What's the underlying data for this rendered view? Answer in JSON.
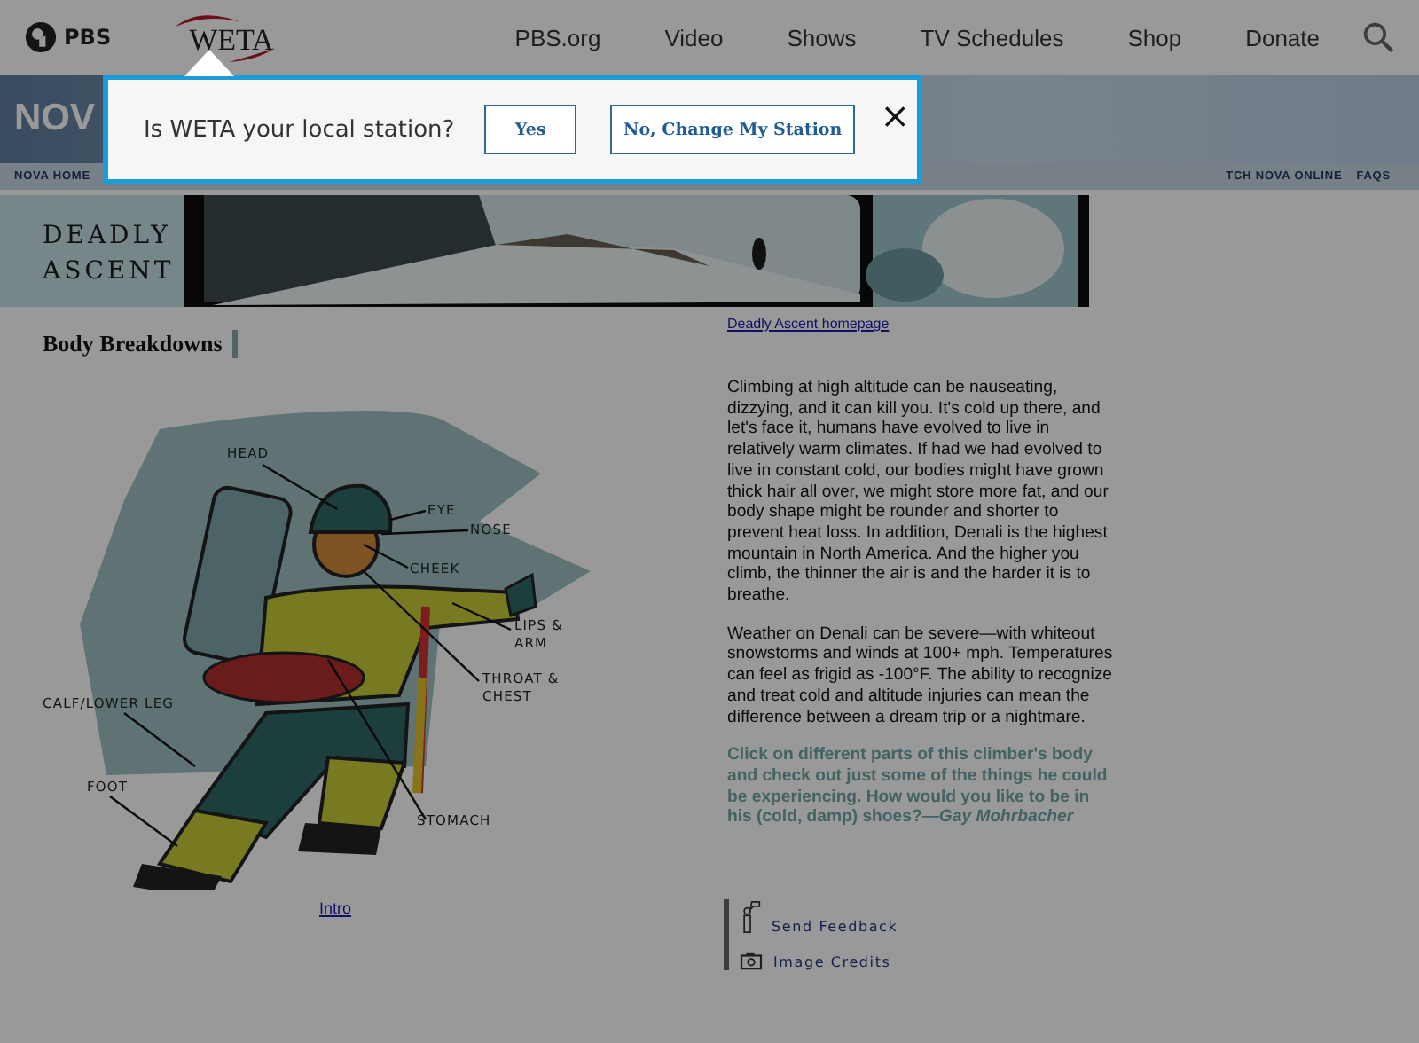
{
  "header": {
    "logos": [
      "PBS",
      "WETA"
    ],
    "nav": [
      "PBS.org",
      "Video",
      "Shows",
      "TV Schedules",
      "Shop",
      "Donate"
    ]
  },
  "nova_bar": {
    "logo": "NOV",
    "links_left": [
      "NOVA HOME"
    ],
    "links_right": [
      "TCH NOVA ONLINE",
      "FAQS"
    ]
  },
  "banner": {
    "title_lines": [
      "DEADLY",
      "ASCENT"
    ]
  },
  "left": {
    "heading": "Body Breakdowns",
    "labels": [
      {
        "text": "HEAD"
      },
      {
        "text": "EYE"
      },
      {
        "text": "NOSE"
      },
      {
        "text": "CHEEK"
      },
      {
        "text": "LIPS & ARM"
      },
      {
        "text": "THROAT & CHEST"
      },
      {
        "text": "CALF/LOWER LEG"
      },
      {
        "text": "FOOT"
      },
      {
        "text": "STOMACH"
      }
    ],
    "link": "Intro"
  },
  "right": {
    "link": "Deadly Ascent homepage",
    "paragraphs": [
      "Climbing at high altitude can be nauseating, dizzying, and it can kill you. It's cold up there, and let's face it, humans have evolved to live in relatively warm climates. If had we had evolved to live in constant cold, our bodies might have grown thick hair all over, we might store more fat, and our body shape might be rounder and shorter to prevent heat loss. In addition, Denali is the highest mountain in North America. And the higher you climb, the thinner the air is and the harder it is to breathe.",
      "Weather on Denali can be severe—with whiteout snowstorms and winds at 100+ mph. Temperatures can feel as frigid as -100°F. The ability to recognize and treat cold and altitude injuries can mean the difference between a dream trip or a nightmare."
    ],
    "callout": "Click on different parts of this climber's body and check out just some of the things he could be experiencing. How would you like to be in his (cold, damp) shoes?*—Gay Mohrbacher*",
    "footer_links": [
      {
        "kind": "feedback",
        "text": "Send Feedback"
      },
      {
        "kind": "credits",
        "text": "Image Credits"
      }
    ]
  },
  "popup": {
    "question": "Is WETA your local station?",
    "buttons": [
      "Yes",
      "No, Change My Station"
    ],
    "close": "×"
  }
}
